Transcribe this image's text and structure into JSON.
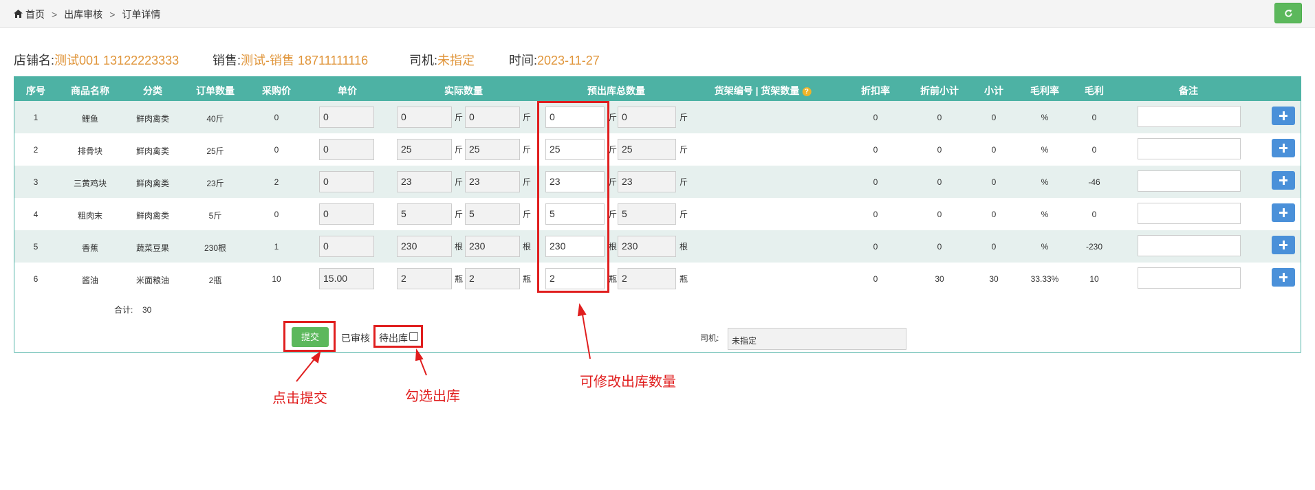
{
  "breadcrumb": {
    "home": "首页",
    "sep": ">",
    "level1": "出库审核",
    "level2": "订单详情"
  },
  "info": {
    "shop_label": "店铺名:",
    "shop_value": "测试001 13122223333",
    "sales_label": "销售:",
    "sales_value": "测试-销售 18711111116",
    "driver_label": "司机:",
    "driver_value": "未指定",
    "time_label": "时间:",
    "time_value": "2023-11-27"
  },
  "columns": {
    "seq": "序号",
    "name": "商品名称",
    "category": "分类",
    "order_qty": "订单数量",
    "purchase_price": "采购价",
    "unit_price": "单价",
    "actual_qty": "实际数量",
    "pre_out_qty": "预出库总数量",
    "shelf": "货架编号 | 货架数量",
    "discount_rate": "折扣率",
    "pre_discount_subtotal": "折前小计",
    "subtotal": "小计",
    "margin_rate": "毛利率",
    "profit": "毛利",
    "remark": "备注"
  },
  "rows": [
    {
      "seq": "1",
      "name": "鲤鱼",
      "category": "鲜肉禽类",
      "order_qty": "40斤",
      "purchase_price": "0",
      "unit_price": "0",
      "actual_a": "0",
      "unit_a": "斤",
      "actual_b": "0",
      "unit_b": "斤",
      "pre_a": "0",
      "unit_c": "斤",
      "pre_b": "0",
      "unit_d": "斤",
      "discount_rate": "0",
      "pre_subtotal": "0",
      "subtotal": "0",
      "margin_rate": "%",
      "profit": "0"
    },
    {
      "seq": "2",
      "name": "排骨块",
      "category": "鲜肉禽类",
      "order_qty": "25斤",
      "purchase_price": "0",
      "unit_price": "0",
      "actual_a": "25",
      "unit_a": "斤",
      "actual_b": "25",
      "unit_b": "斤",
      "pre_a": "25",
      "unit_c": "斤",
      "pre_b": "25",
      "unit_d": "斤",
      "discount_rate": "0",
      "pre_subtotal": "0",
      "subtotal": "0",
      "margin_rate": "%",
      "profit": "0"
    },
    {
      "seq": "3",
      "name": "三黄鸡块",
      "category": "鲜肉禽类",
      "order_qty": "23斤",
      "purchase_price": "2",
      "unit_price": "0",
      "actual_a": "23",
      "unit_a": "斤",
      "actual_b": "23",
      "unit_b": "斤",
      "pre_a": "23",
      "unit_c": "斤",
      "pre_b": "23",
      "unit_d": "斤",
      "discount_rate": "0",
      "pre_subtotal": "0",
      "subtotal": "0",
      "margin_rate": "%",
      "profit": "-46"
    },
    {
      "seq": "4",
      "name": "粗肉末",
      "category": "鲜肉禽类",
      "order_qty": "5斤",
      "purchase_price": "0",
      "unit_price": "0",
      "actual_a": "5",
      "unit_a": "斤",
      "actual_b": "5",
      "unit_b": "斤",
      "pre_a": "5",
      "unit_c": "斤",
      "pre_b": "5",
      "unit_d": "斤",
      "discount_rate": "0",
      "pre_subtotal": "0",
      "subtotal": "0",
      "margin_rate": "%",
      "profit": "0"
    },
    {
      "seq": "5",
      "name": "香蕉",
      "category": "蔬菜豆果",
      "order_qty": "230根",
      "purchase_price": "1",
      "unit_price": "0",
      "actual_a": "230",
      "unit_a": "根",
      "actual_b": "230",
      "unit_b": "根",
      "pre_a": "230",
      "unit_c": "根",
      "pre_b": "230",
      "unit_d": "根",
      "discount_rate": "0",
      "pre_subtotal": "0",
      "subtotal": "0",
      "margin_rate": "%",
      "profit": "-230"
    },
    {
      "seq": "6",
      "name": "酱油",
      "category": "米面粮油",
      "order_qty": "2瓶",
      "purchase_price": "10",
      "unit_price": "15.00",
      "actual_a": "2",
      "unit_a": "瓶",
      "actual_b": "2",
      "unit_b": "瓶",
      "pre_a": "2",
      "unit_c": "瓶",
      "pre_b": "2",
      "unit_d": "瓶",
      "discount_rate": "0",
      "pre_subtotal": "30",
      "subtotal": "30",
      "margin_rate": "33.33%",
      "profit": "10"
    }
  ],
  "totals": {
    "label": "合计:",
    "value": "30"
  },
  "footer": {
    "submit_label": "提交",
    "audited_label": "已审核",
    "pending_label": "待出库",
    "driver_label": "司机:",
    "driver_value": "未指定"
  },
  "annotations": {
    "submit_note": "点击提交",
    "check_note": "勾选出库",
    "modify_note": "可修改出库数量"
  },
  "colors": {
    "header_bg": "#4db2a4",
    "accent_orange": "#e0953a",
    "annotation_red": "#e01e1e",
    "button_green": "#5cb85c",
    "button_blue": "#4a90d9"
  }
}
